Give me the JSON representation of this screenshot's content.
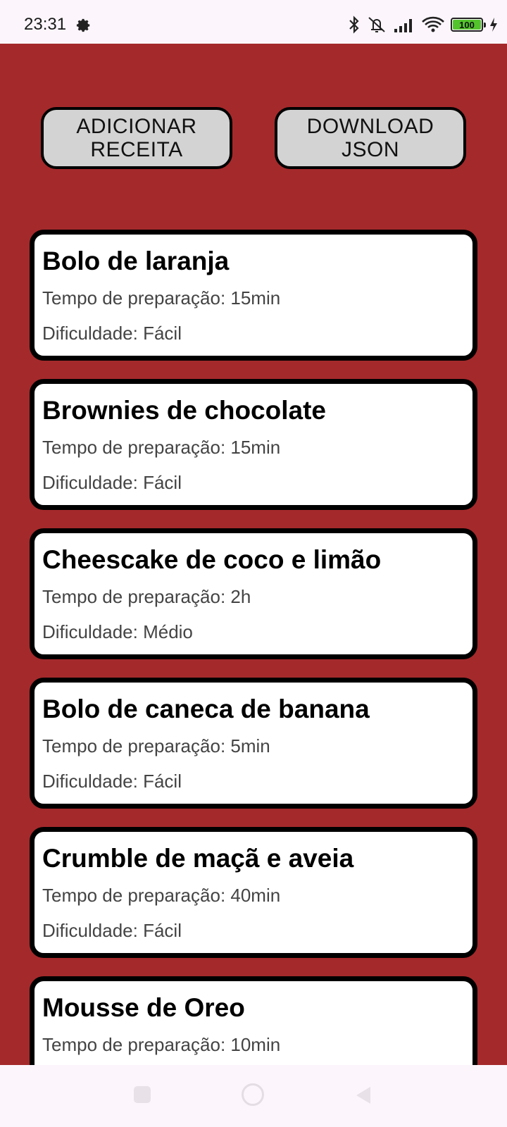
{
  "status_bar": {
    "time": "23:31",
    "battery_level": "100",
    "icons": [
      "settings-icon",
      "bluetooth-icon",
      "muted-vibrate-icon",
      "signal-icon",
      "wifi-icon",
      "battery-icon",
      "charging-icon"
    ]
  },
  "toolbar": {
    "add_label": "ADICIONAR\nRECEITA",
    "download_label": "DOWNLOAD\nJSON"
  },
  "recipes": [
    {
      "name": "Bolo de laranja",
      "time": "Tempo de preparação: 15min",
      "difficulty": "Dificuldade: Fácil"
    },
    {
      "name": "Brownies de chocolate",
      "time": "Tempo de preparação: 15min",
      "difficulty": "Dificuldade: Fácil"
    },
    {
      "name": "Cheescake de coco e limão",
      "time": "Tempo de preparação: 2h",
      "difficulty": "Dificuldade: Médio"
    },
    {
      "name": "Bolo de caneca de banana",
      "time": "Tempo de preparação: 5min",
      "difficulty": "Dificuldade: Fácil"
    },
    {
      "name": "Crumble de maçã e aveia",
      "time": "Tempo de preparação: 40min",
      "difficulty": "Dificuldade: Fácil"
    },
    {
      "name": "Mousse de Oreo",
      "time": "Tempo de preparação: 10min",
      "difficulty": ""
    }
  ],
  "colors": {
    "background": "#a4292b",
    "button": "#d3d3d3",
    "card": "#ffffff",
    "border": "#000000"
  },
  "nav_bar": {
    "icons": [
      "recents-icon",
      "home-icon",
      "back-icon"
    ]
  }
}
